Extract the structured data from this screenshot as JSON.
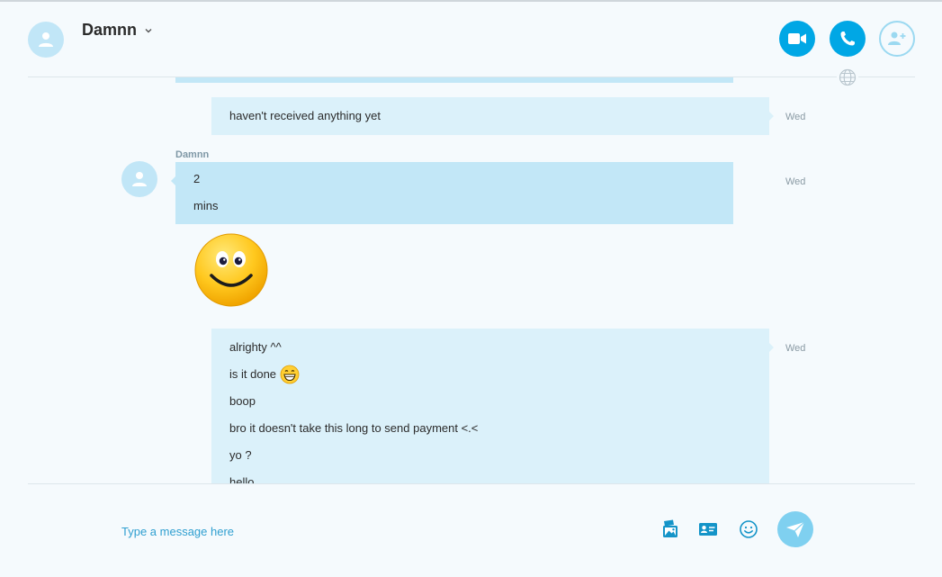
{
  "header": {
    "contact_name": "Damnn"
  },
  "messages": {
    "out_1": {
      "text": "haven't received anything yet",
      "time": "Wed"
    },
    "in_group": {
      "sender": "Damnn",
      "lines": [
        "2",
        "mins"
      ],
      "time": "Wed"
    },
    "out_2": {
      "lines": [
        "alrighty ^^",
        "is it done",
        "boop",
        "bro it doesn't take this long to send payment <.<",
        "yo ?",
        "hello"
      ],
      "time": "Wed"
    }
  },
  "composer": {
    "placeholder": "Type a message here"
  },
  "colors": {
    "accent": "#00a7e5",
    "bubble_out": "#dbf1fa",
    "bubble_in": "#c2e7f7"
  }
}
